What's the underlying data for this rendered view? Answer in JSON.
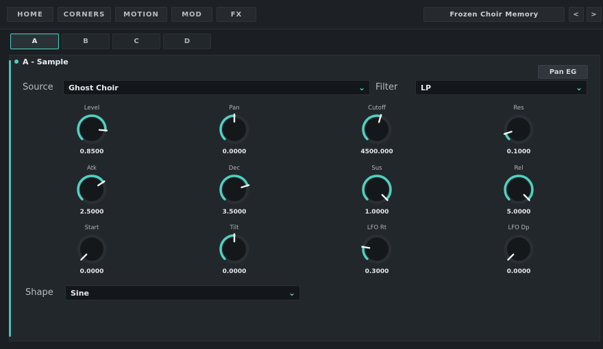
{
  "nav": {
    "tabs": [
      "HOME",
      "CORNERS",
      "MOTION",
      "MOD",
      "FX"
    ],
    "preset_name": "Frozen Choir Memory",
    "prev": "<",
    "next": ">"
  },
  "layers": {
    "tabs": [
      "A",
      "B",
      "C",
      "D"
    ],
    "active": "A"
  },
  "section": {
    "title": "A - Sample",
    "button": "Pan EG"
  },
  "source": {
    "label": "Source",
    "value": "Ghost Choir"
  },
  "filter": {
    "label": "Filter",
    "value": "LP"
  },
  "shape": {
    "label": "Shape",
    "value": "Sine"
  },
  "knobs": [
    {
      "label": "Level",
      "value": "0.8500",
      "level": 0.85
    },
    {
      "label": "Pan",
      "value": "0.0000",
      "level": 0.5
    },
    {
      "label": "Cutoff",
      "value": "4500.000",
      "level": 0.56
    },
    {
      "label": "Res",
      "value": "0.1000",
      "level": 0.1
    },
    {
      "label": "Atk",
      "value": "2.5000",
      "level": 0.71
    },
    {
      "label": "Dec",
      "value": "3.5000",
      "level": 0.77
    },
    {
      "label": "Sus",
      "value": "1.0000",
      "level": 1.0
    },
    {
      "label": "Rel",
      "value": "5.0000",
      "level": 1.0
    },
    {
      "label": "Start",
      "value": "0.0000",
      "level": 0.0
    },
    {
      "label": "Tilt",
      "value": "0.0000",
      "level": 0.5
    },
    {
      "label": "LFO Rt",
      "value": "0.3000",
      "level": 0.2
    },
    {
      "label": "LFO Dp",
      "value": "0.0000",
      "level": 0.0
    }
  ],
  "colors": {
    "accent": "#4fd1c0",
    "track": "#2a2f33",
    "knob_face": "#15181b"
  }
}
